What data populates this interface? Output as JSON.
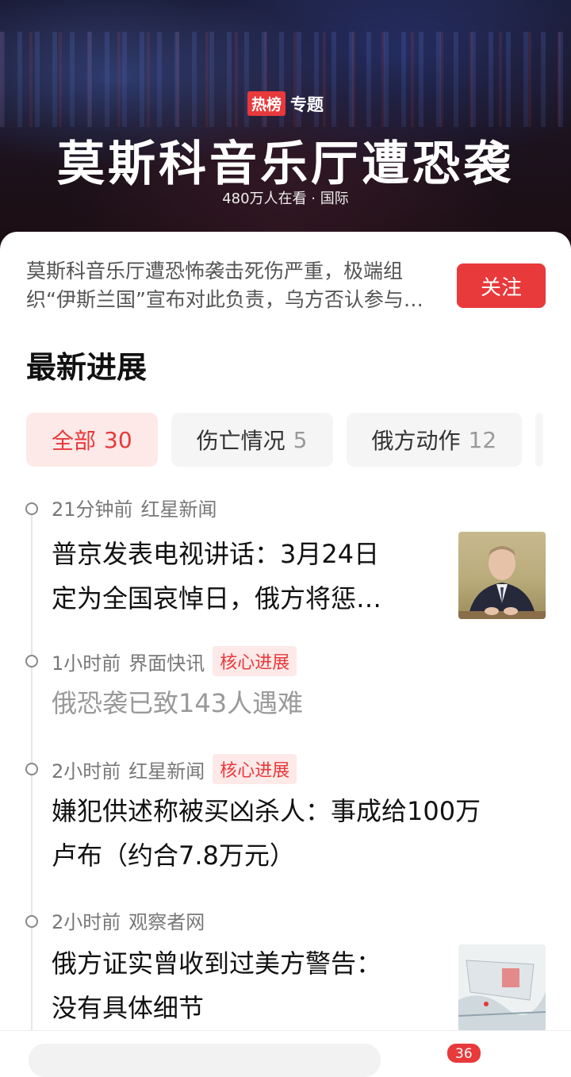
{
  "hero": {
    "badge_hot": "热榜",
    "badge_topic": "专题",
    "title": "莫斯科音乐厅遭恐袭",
    "subtitle": "480万人在看 · 国际"
  },
  "summary": "莫斯科音乐厅遭恐怖袭击死伤严重，极端组织“伊斯兰国”宣布对此负责，乌方否认参与，俄方称袭击者试图逃往乌克兰",
  "follow_label": "关注",
  "section_title": "最新进展",
  "filters": [
    {
      "label": "全部",
      "count": "30"
    },
    {
      "label": "伤亡情况",
      "count": "5"
    },
    {
      "label": "俄方动作",
      "count": "12"
    }
  ],
  "timeline": [
    {
      "time": "21分钟前",
      "source": "红星新闻",
      "tag": "",
      "line1": "普京发表电视讲话：3月24日",
      "line2": "定为全国哀悼日，俄方将惩…"
    },
    {
      "time": "1小时前",
      "source": "界面快讯",
      "tag": "核心进展",
      "line1": "俄恐袭已致143人遇难",
      "line2": ""
    },
    {
      "time": "2小时前",
      "source": "红星新闻",
      "tag": "核心进展",
      "line1": "嫌犯供述称被买凶杀人：事成给100万",
      "line2": "卢布（约合7.8万元）"
    },
    {
      "time": "2小时前",
      "source": "观察者网",
      "tag": "",
      "line1": "俄方证实曾收到过美方警告：",
      "line2": "没有具体细节"
    }
  ],
  "bottom": {
    "comment_count": "36"
  }
}
